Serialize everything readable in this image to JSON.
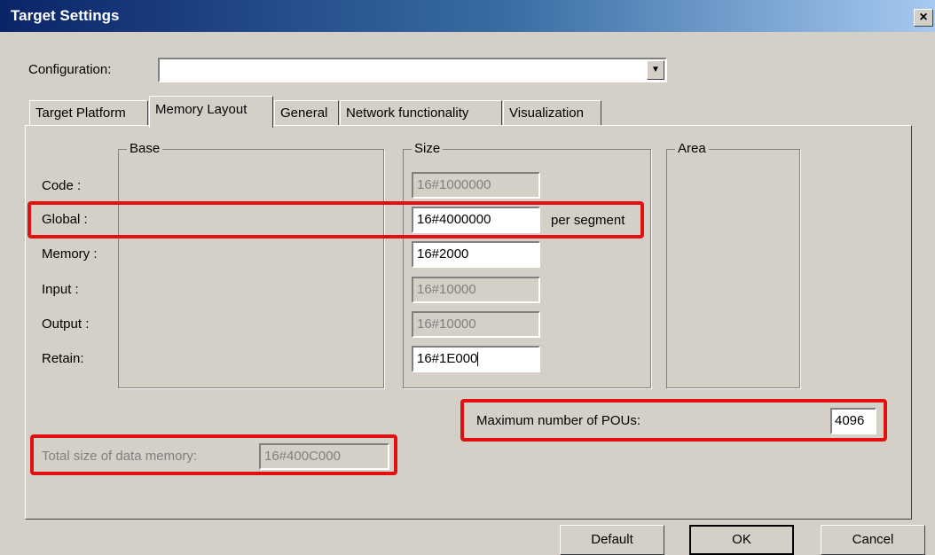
{
  "window": {
    "title": "Target Settings",
    "close_glyph": "×"
  },
  "configuration": {
    "label": "Configuration:",
    "value": ""
  },
  "tabs": [
    {
      "label": "Target Platform",
      "active": false
    },
    {
      "label": "Memory Layout",
      "active": true
    },
    {
      "label": "General",
      "active": false
    },
    {
      "label": "Network functionality",
      "active": false
    },
    {
      "label": "Visualization",
      "active": false
    }
  ],
  "groups": {
    "base": "Base",
    "size": "Size",
    "area": "Area"
  },
  "rows": [
    {
      "label": "Code :",
      "size": "16#1000000",
      "editable": false
    },
    {
      "label": "Global :",
      "size": "16#4000000",
      "editable": true,
      "suffix": "per segment"
    },
    {
      "label": "Memory :",
      "size": "16#2000",
      "editable": true
    },
    {
      "label": "Input :",
      "size": "16#10000",
      "editable": false
    },
    {
      "label": "Output :",
      "size": "16#10000",
      "editable": false
    },
    {
      "label": "Retain:",
      "size": "16#1E000",
      "editable": true
    }
  ],
  "max_pous": {
    "label": "Maximum number of POUs:",
    "value": "4096"
  },
  "total_size": {
    "label": "Total size of data memory:",
    "value": "16#400C000"
  },
  "buttons": {
    "default": "Default",
    "ok": "OK",
    "cancel": "Cancel"
  },
  "colors": {
    "highlight": "#e01010",
    "title_bar": "#0a246a",
    "dialog": "#d4d0c8"
  }
}
